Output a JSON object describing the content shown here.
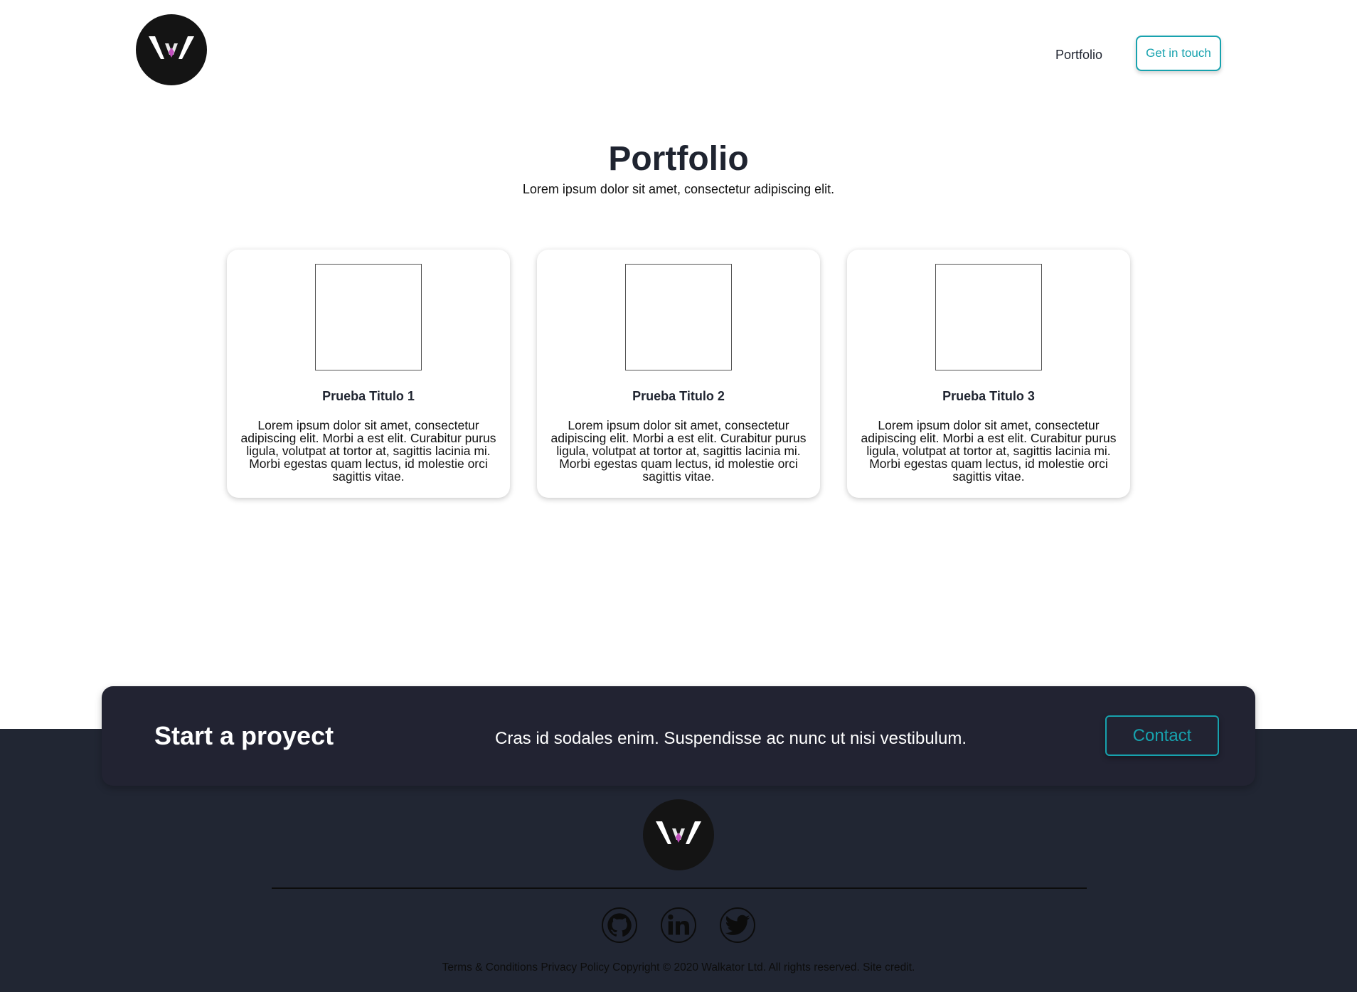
{
  "header": {
    "logo_icon": "walkator-w-logo",
    "nav": {
      "portfolio_label": "Portfolio"
    },
    "cta_label": "Get in touch"
  },
  "hero": {
    "title": "Portfolio",
    "subtitle": "Lorem ipsum dolor sit amet, consectetur adipiscing elit."
  },
  "cards": [
    {
      "title": "Prueba Titulo 1",
      "text": "Lorem ipsum dolor sit amet, consectetur adipiscing elit. Morbi a est elit. Curabitur purus ligula, volutpat at tortor at, sagittis lacinia mi. Morbi egestas quam lectus, id molestie orci sagittis vitae."
    },
    {
      "title": "Prueba Titulo 2",
      "text": "Lorem ipsum dolor sit amet, consectetur adipiscing elit. Morbi a est elit. Curabitur purus ligula, volutpat at tortor at, sagittis lacinia mi. Morbi egestas quam lectus, id molestie orci sagittis vitae."
    },
    {
      "title": "Prueba Titulo 3",
      "text": "Lorem ipsum dolor sit amet, consectetur adipiscing elit. Morbi a est elit. Curabitur purus ligula, volutpat at tortor at, sagittis lacinia mi. Morbi egestas quam lectus, id molestie orci sagittis vitae."
    }
  ],
  "cta": {
    "title": "Start a proyect",
    "text": "Cras id sodales enim. Suspendisse ac nunc ut nisi vestibulum.",
    "button_label": "Contact"
  },
  "footer": {
    "social": [
      "github-icon",
      "linkedin-icon",
      "twitter-icon"
    ],
    "links_text": "Terms & Conditions Privacy Policy Copyright © 2020 Walkator Ltd. All rights reserved. Site credit."
  },
  "colors": {
    "accent": "#17a2ae",
    "text_dark": "#1f2430",
    "footer_bg": "#212633",
    "banner_bg": "#222332",
    "logo_bg": "#141414"
  }
}
